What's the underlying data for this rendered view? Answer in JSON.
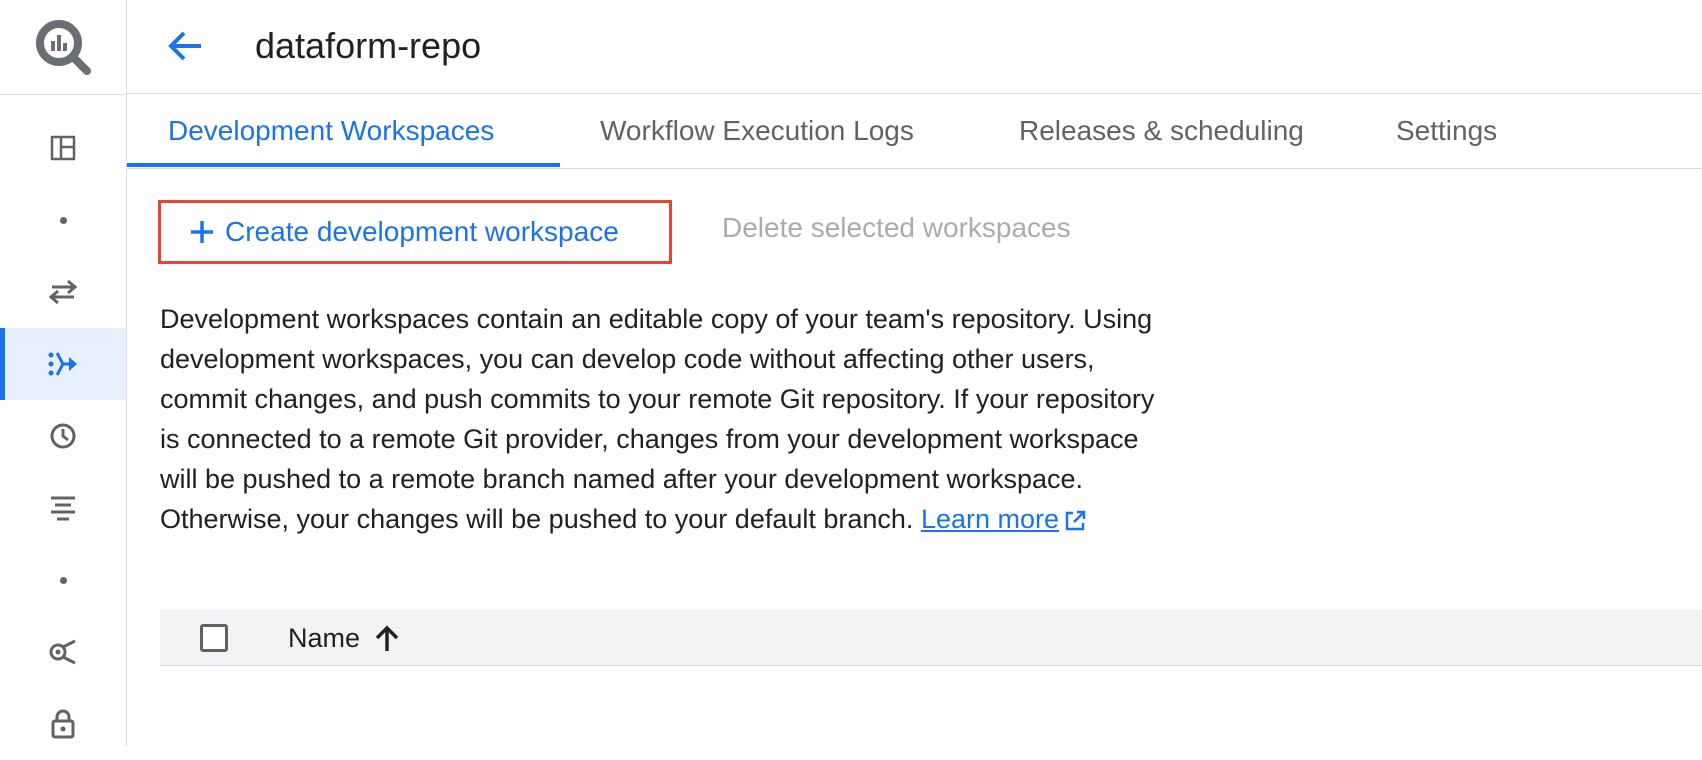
{
  "app": {
    "logo_icon": "bigquery-logo-icon",
    "accent_color": "#1a73e8",
    "highlight_color": "#ea4335"
  },
  "header": {
    "back_icon": "arrow-back-icon",
    "title": "dataform-repo"
  },
  "rail": {
    "items": [
      {
        "icon": "dashboard-panel-icon"
      },
      {
        "icon": "dot-icon"
      },
      {
        "icon": "transfer-arrows-icon"
      },
      {
        "icon": "dataform-pipeline-icon",
        "active": true
      },
      {
        "icon": "history-clock-icon"
      },
      {
        "icon": "lineage-lines-icon"
      },
      {
        "icon": "dot-icon"
      },
      {
        "icon": "analytics-hub-icon"
      },
      {
        "icon": "lock-icon"
      }
    ]
  },
  "tabs": [
    {
      "label": "Development Workspaces",
      "active": true
    },
    {
      "label": "Workflow Execution Logs"
    },
    {
      "label": "Releases & scheduling"
    },
    {
      "label": "Settings"
    }
  ],
  "actions": {
    "create_label": "Create development workspace",
    "delete_label": "Delete selected workspaces"
  },
  "description": {
    "text": "Development workspaces contain an editable copy of your team's repository. Using development workspaces, you can develop code without affecting other users, commit changes, and push commits to your remote Git repository. If your repository is connected to a remote Git provider, changes from your development workspace will be pushed to a remote branch named after your development workspace. Otherwise, your changes will be pushed to your default branch.",
    "learn_more": "Learn more"
  },
  "table": {
    "columns": [
      {
        "label": "Name",
        "sort": "ascending"
      }
    ]
  }
}
